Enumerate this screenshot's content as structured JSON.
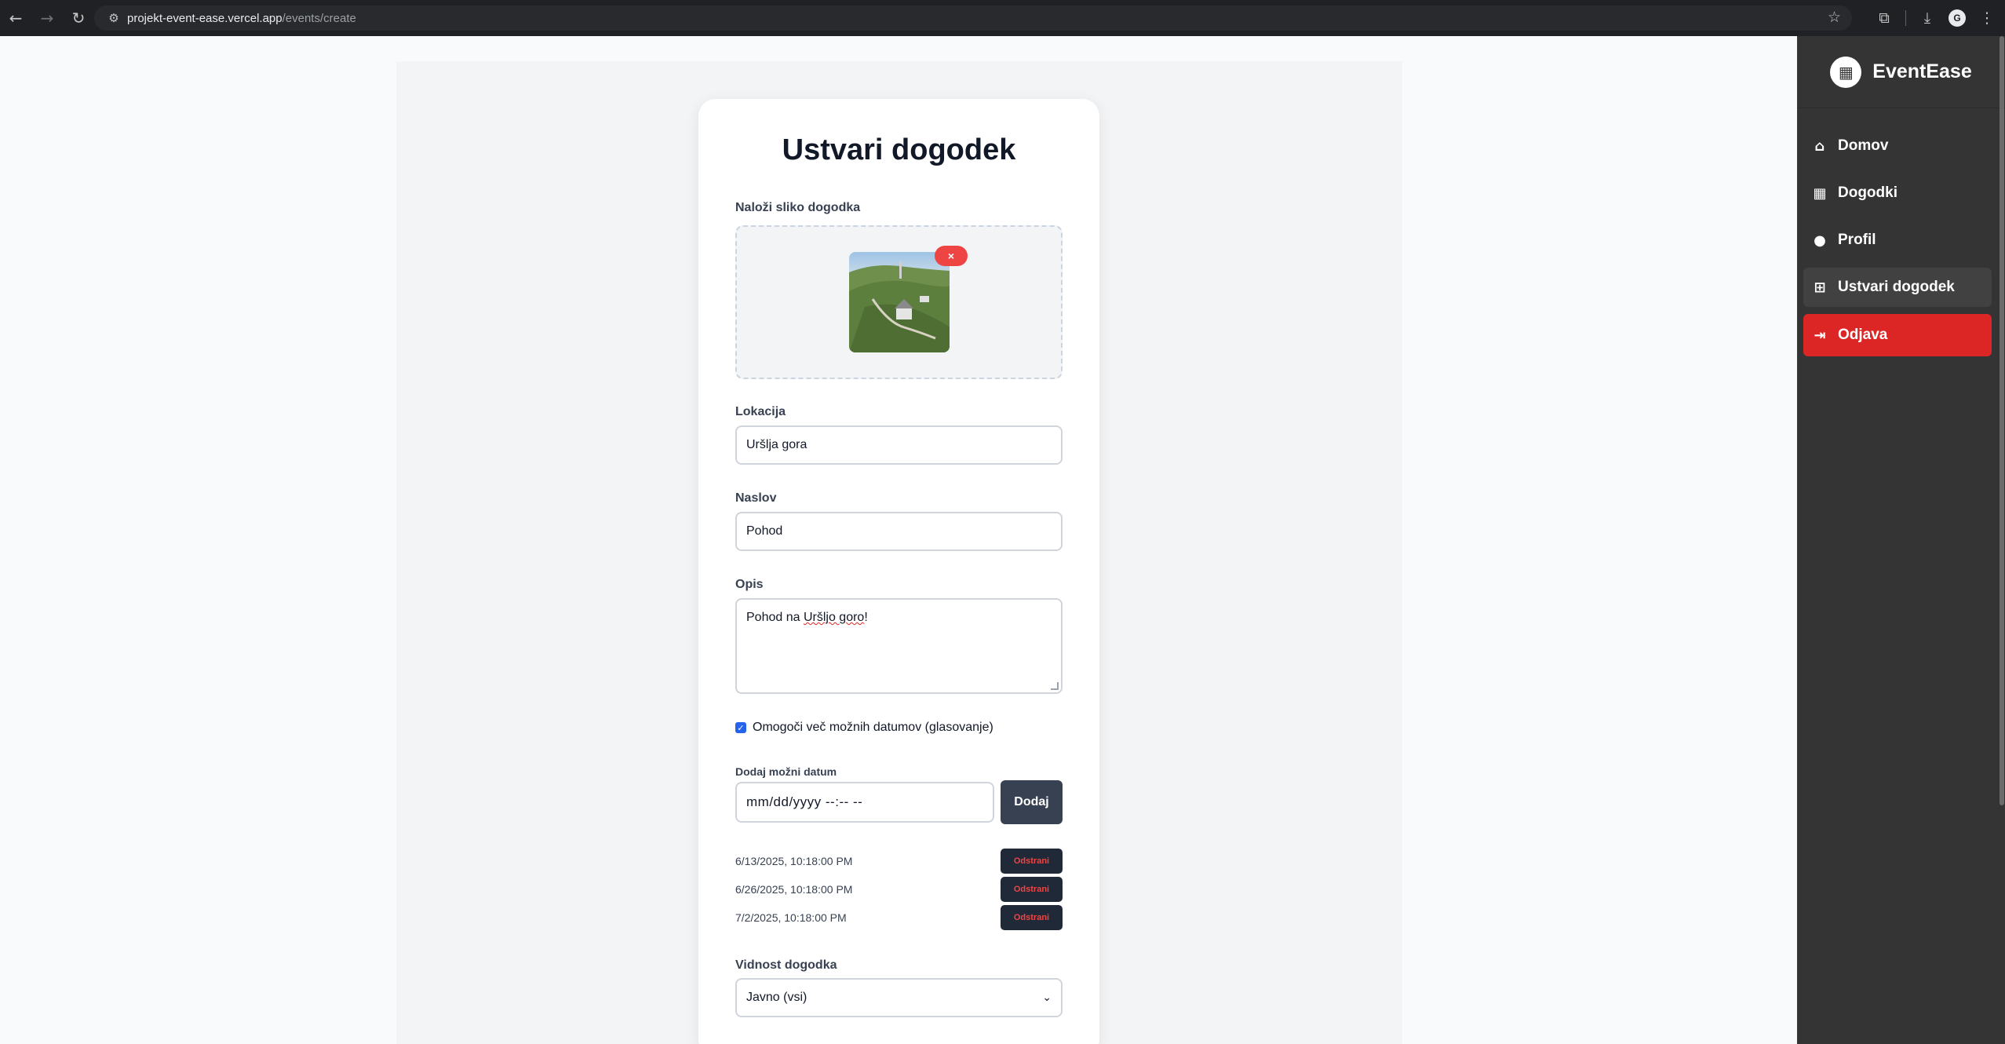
{
  "browser": {
    "url_host": "projekt-event-ease.vercel.app",
    "url_path": "/events/create",
    "profile_initial": "G"
  },
  "form": {
    "title": "Ustvari dogodek",
    "image_label": "Naloži sliko dogodka",
    "remove_image_label": "×",
    "location_label": "Lokacija",
    "location_value": "Uršlja gora",
    "title_label": "Naslov",
    "title_value": "Pohod",
    "description_label": "Opis",
    "description_prefix": "Pohod na ",
    "description_misspelled": "Uršljo goro",
    "description_suffix": "!",
    "multi_date_label": "Omogoči več možnih datumov (glasovanje)",
    "multi_date_checked": true,
    "add_date_label": "Dodaj možni datum",
    "date_placeholder": "mm/dd/yyyy --:-- --",
    "add_button": "Dodaj",
    "dates": [
      {
        "value": "6/13/2025, 10:18:00 PM",
        "remove": "Odstrani"
      },
      {
        "value": "6/26/2025, 10:18:00 PM",
        "remove": "Odstrani"
      },
      {
        "value": "7/2/2025, 10:18:00 PM",
        "remove": "Odstrani"
      }
    ],
    "visibility_label": "Vidnost dogodka",
    "visibility_value": "Javno (vsi)"
  },
  "sidebar": {
    "brand": "EventEase",
    "items": [
      {
        "label": "Domov",
        "icon": "home-icon"
      },
      {
        "label": "Dogodki",
        "icon": "calendar-icon"
      },
      {
        "label": "Profil",
        "icon": "user-icon"
      },
      {
        "label": "Ustvari dogodek",
        "icon": "plus-square-icon",
        "active": true
      },
      {
        "label": "Odjava",
        "icon": "logout-icon"
      }
    ]
  },
  "colors": {
    "accent": "#dc2626",
    "sidebar_bg": "#343434",
    "button_dark": "#374151"
  }
}
